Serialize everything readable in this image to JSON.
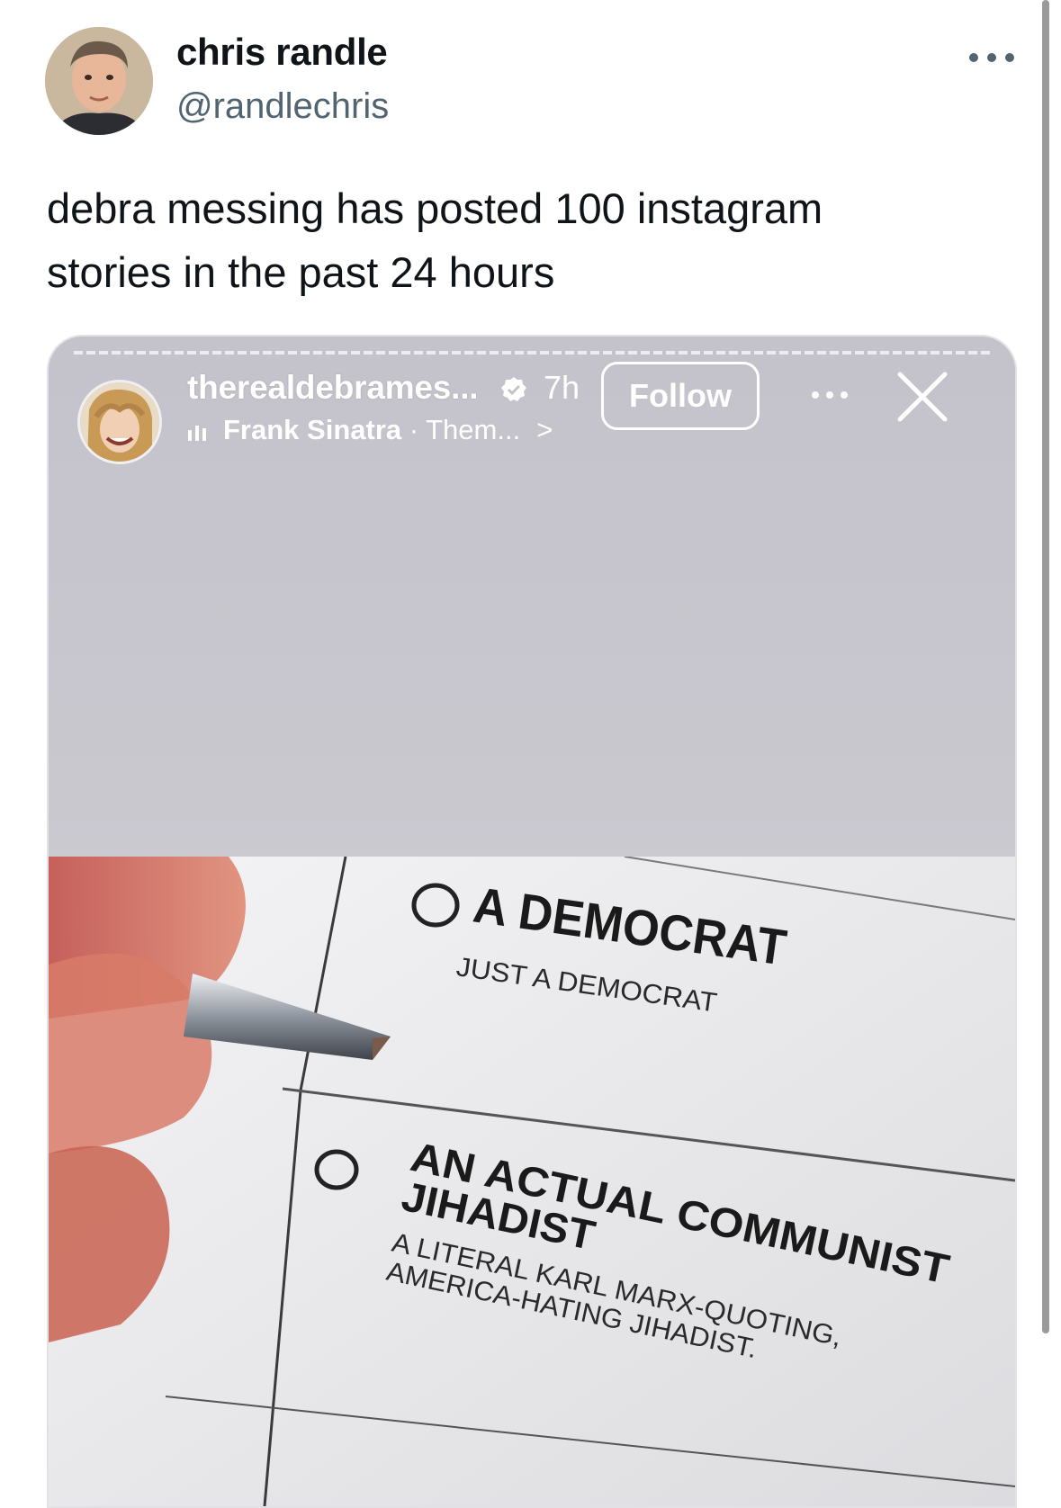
{
  "tweet": {
    "author": {
      "display_name": "chris randle",
      "handle": "@randlechris",
      "avatar_icon": "profile-photo"
    },
    "more_icon": "more-horizontal-icon",
    "text_lines": [
      "debra messing has posted 100 instagram",
      "stories in the past 24 hours"
    ]
  },
  "story": {
    "username": "therealdebrames...",
    "verified_icon": "verified-badge-icon",
    "time": "7h",
    "music_icon": "music-bars-icon",
    "music_artist": "Frank Sinatra",
    "music_separator": " · ",
    "music_track": "Them...",
    "music_chevron": ">",
    "follow_label": "Follow",
    "more_icon": "more-horizontal-icon",
    "close_icon": "close-icon",
    "ballot": {
      "option_1_title": "A DEMOCRAT",
      "option_1_sub": "JUST A DEMOCRAT",
      "option_2_title_line1": "AN ACTUAL COMMUNIST",
      "option_2_title_line2": "JIHADIST",
      "option_2_sub_line1": "A LITERAL KARL MARX-QUOTING,",
      "option_2_sub_line2": "AMERICA-HATING JIHADIST."
    }
  },
  "colors": {
    "text_primary": "#0f1419",
    "text_secondary": "#536471",
    "story_bg": "#c9c8cf"
  }
}
